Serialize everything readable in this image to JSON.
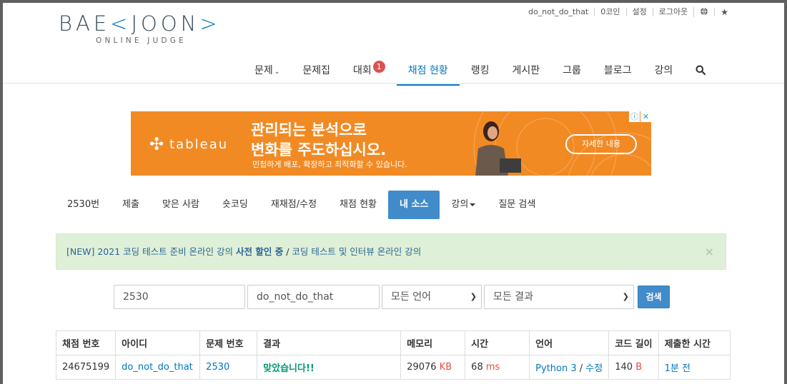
{
  "logo": {
    "left_text": "BAE",
    "accent_left": "<",
    "right_text": "JOON",
    "accent_right": ">",
    "subtitle": "ONLINE JUDGE"
  },
  "topbar": {
    "username": "do_not_do_that",
    "coins": "0코인",
    "settings": "설정",
    "logout": "로그아웃"
  },
  "nav": {
    "items": [
      {
        "label": "문제",
        "dropdown": true
      },
      {
        "label": "문제집"
      },
      {
        "label": "대회",
        "badge": "1"
      },
      {
        "label": "채점 현황",
        "active": true
      },
      {
        "label": "랭킹"
      },
      {
        "label": "게시판"
      },
      {
        "label": "그룹"
      },
      {
        "label": "블로그"
      },
      {
        "label": "강의"
      }
    ]
  },
  "ad": {
    "brand": "tableau",
    "headline_1": "관리되는 분석으로",
    "headline_2": "변화를 주도하십시오.",
    "subline": "민첩하게 배포, 확장하고 최적화할 수 있습니다.",
    "cta": "자세한 내용"
  },
  "problem_tabs": [
    {
      "label": "2530번"
    },
    {
      "label": "제출"
    },
    {
      "label": "맞은 사람"
    },
    {
      "label": "숏코딩"
    },
    {
      "label": "재채점/수정"
    },
    {
      "label": "채점 현황"
    },
    {
      "label": "내 소스",
      "active": true
    },
    {
      "label": "강의",
      "dropdown": true
    },
    {
      "label": "질문 검색"
    }
  ],
  "alert": {
    "prefix": "[NEW] 2021 코딩 테스트 준비 온라인 강의",
    "bold": "사전 할인 중",
    "separator": " / ",
    "second": "코딩 테스트 및 인터뷰 온라인 강의",
    "close": "×"
  },
  "filters": {
    "problem_id": "2530",
    "user_id": "do_not_do_that",
    "language": "모든 언어",
    "result": "모든 결과",
    "search_button": "검색"
  },
  "table": {
    "headers": [
      "채점 번호",
      "아이디",
      "문제 번호",
      "결과",
      "메모리",
      "시간",
      "언어",
      "코드 길이",
      "제출한 시간"
    ],
    "rows": [
      {
        "submission_id": "24675199",
        "user": "do_not_do_that",
        "problem": "2530",
        "result": "맞았습니다!!",
        "memory": "29076",
        "memory_unit": "KB",
        "time": "68",
        "time_unit": "ms",
        "language": "Python 3",
        "lang_sep": " / ",
        "edit": "수정",
        "code_length": "140",
        "code_unit": "B",
        "submitted": "1분 전"
      }
    ]
  },
  "colors": {
    "brand_blue": "#0076c0",
    "button_blue": "#428bca",
    "ad_orange": "#f28a24",
    "ok_green": "#009874",
    "unit_red": "#e74c3c",
    "alert_bg": "#dff0d8"
  }
}
